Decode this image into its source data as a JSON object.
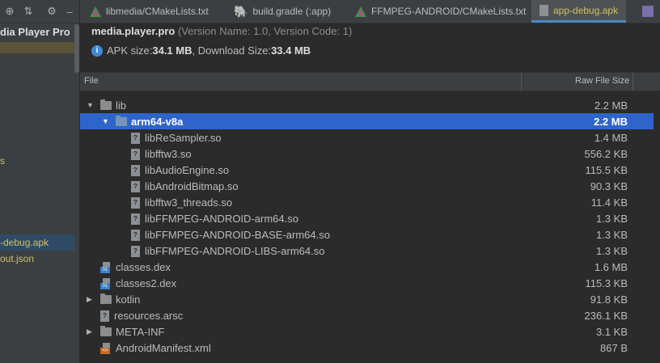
{
  "left_pane": {
    "title": "dia Player Pro",
    "items": [
      {
        "label": "s"
      },
      {
        "label": "-debug.apk"
      },
      {
        "label": "out.json"
      }
    ]
  },
  "tabs": [
    {
      "label": "libmedia/CMakeLists.txt",
      "icon": "cmake-icon"
    },
    {
      "label": "build.gradle (:app)",
      "icon": "gradle-icon"
    },
    {
      "label": "FFMPEG-ANDROID/CMakeLists.txt",
      "icon": "cmake-icon"
    },
    {
      "label": "app-debug.apk",
      "icon": "apk-icon"
    }
  ],
  "apk": {
    "package": "media.player.pro",
    "version": "(Version Name: 1.0, Version Code: 1)",
    "apk_size_label": "APK size: ",
    "apk_size": "34.1 MB",
    "download_label": ", Download Size: ",
    "download_size": "33.4 MB"
  },
  "table": {
    "col_file": "File",
    "col_size": "Raw File Size",
    "rows": [
      {
        "name": "lib",
        "size": "2.2 MB",
        "type": "folder",
        "expanded": true
      },
      {
        "name": "arm64-v8a",
        "size": "2.2 MB",
        "type": "folder",
        "expanded": true,
        "selected": true
      },
      {
        "name": "libReSampler.so",
        "size": "1.4 MB",
        "type": "so"
      },
      {
        "name": "libfftw3.so",
        "size": "556.2 KB",
        "type": "so"
      },
      {
        "name": "libAudioEngine.so",
        "size": "115.5 KB",
        "type": "so"
      },
      {
        "name": "libAndroidBitmap.so",
        "size": "90.3 KB",
        "type": "so"
      },
      {
        "name": "libfftw3_threads.so",
        "size": "11.4 KB",
        "type": "so"
      },
      {
        "name": "libFFMPEG-ANDROID-arm64.so",
        "size": "1.3 KB",
        "type": "so"
      },
      {
        "name": "libFFMPEG-ANDROID-BASE-arm64.so",
        "size": "1.3 KB",
        "type": "so"
      },
      {
        "name": "libFFMPEG-ANDROID-LIBS-arm64.so",
        "size": "1.3 KB",
        "type": "so"
      },
      {
        "name": "classes.dex",
        "size": "1.6 MB",
        "type": "dex"
      },
      {
        "name": "classes2.dex",
        "size": "115.3 KB",
        "type": "dex"
      },
      {
        "name": "kotlin",
        "size": "91.8 KB",
        "type": "folder",
        "expanded": false
      },
      {
        "name": "resources.arsc",
        "size": "236.1 KB",
        "type": "arsc"
      },
      {
        "name": "META-INF",
        "size": "3.1 KB",
        "type": "folder",
        "expanded": false
      },
      {
        "name": "AndroidManifest.xml",
        "size": "867 B",
        "type": "xml"
      }
    ]
  }
}
